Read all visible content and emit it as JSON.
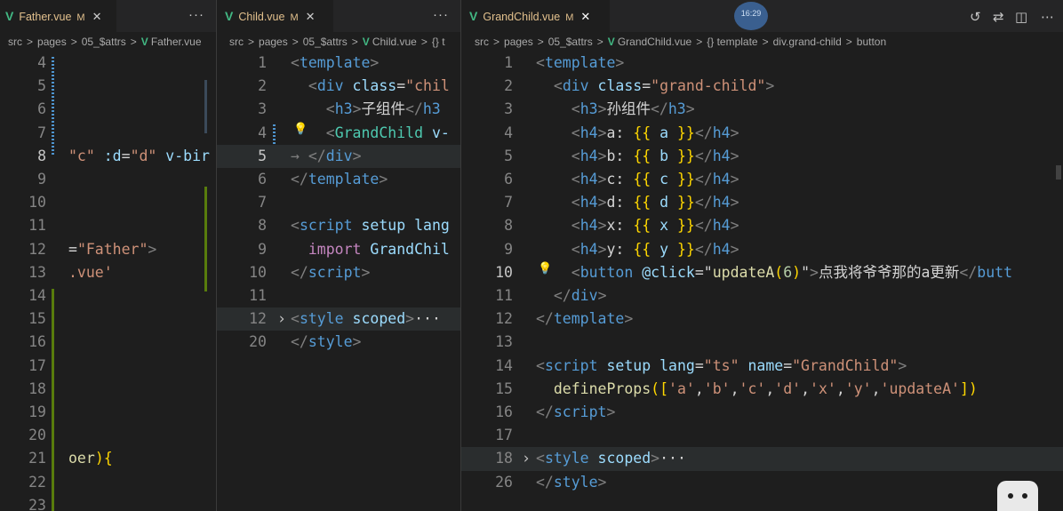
{
  "panes": [
    {
      "tab": {
        "name": "Father.vue",
        "modified": "M",
        "close": "✕"
      },
      "more": "···",
      "breadcrumb": [
        "src",
        "pages",
        "05_$attrs",
        "Father.vue"
      ],
      "lines": [
        {
          "n": "4",
          "t": []
        },
        {
          "n": "5",
          "t": []
        },
        {
          "n": "6",
          "t": []
        },
        {
          "n": "7",
          "t": []
        },
        {
          "n": "8",
          "t": [
            [
              "sv",
              "\"c\""
            ],
            [
              "an",
              " :d"
            ],
            [
              "pl",
              "="
            ],
            [
              "sv",
              "\"d\""
            ],
            [
              "an",
              " v-bir"
            ]
          ]
        },
        {
          "n": "9",
          "t": []
        },
        {
          "n": "10",
          "t": []
        },
        {
          "n": "11",
          "t": []
        },
        {
          "n": "12",
          "t": [
            [
              "pl",
              "="
            ],
            [
              "sv",
              "\"Father\""
            ],
            [
              "tb",
              ">"
            ]
          ]
        },
        {
          "n": "13",
          "t": [
            [
              "sv",
              ".vue'"
            ]
          ]
        },
        {
          "n": "14",
          "t": []
        },
        {
          "n": "15",
          "t": []
        },
        {
          "n": "16",
          "t": []
        },
        {
          "n": "17",
          "t": []
        },
        {
          "n": "18",
          "t": []
        },
        {
          "n": "19",
          "t": []
        },
        {
          "n": "20",
          "t": []
        },
        {
          "n": "21",
          "t": [
            [
              "fn",
              "oer"
            ],
            [
              "br",
              ")"
            ],
            [
              "br",
              "{"
            ]
          ]
        },
        {
          "n": "22",
          "t": []
        },
        {
          "n": "23",
          "t": []
        }
      ]
    },
    {
      "tab": {
        "name": "Child.vue",
        "modified": "M",
        "close": "✕"
      },
      "more": "···",
      "breadcrumb": [
        "src",
        "pages",
        "05_$attrs",
        "Child.vue",
        "{} t"
      ],
      "lines": [
        {
          "n": "1",
          "t": [
            [
              "tb",
              "<"
            ],
            [
              "tg",
              "template"
            ],
            [
              "tb",
              ">"
            ]
          ]
        },
        {
          "n": "2",
          "t": [
            [
              "pl",
              "  "
            ],
            [
              "tb",
              "<"
            ],
            [
              "tg",
              "div"
            ],
            [
              "an",
              " class"
            ],
            [
              "pl",
              "="
            ],
            [
              "sv",
              "\"chil"
            ]
          ]
        },
        {
          "n": "3",
          "t": [
            [
              "pl",
              "    "
            ],
            [
              "tb",
              "<"
            ],
            [
              "tg",
              "h3"
            ],
            [
              "tb",
              ">"
            ],
            [
              "pl",
              "子组件"
            ],
            [
              "tb",
              "</"
            ],
            [
              "tg",
              "h3"
            ]
          ]
        },
        {
          "n": "4",
          "t": [
            [
              "pl",
              "    "
            ],
            [
              "tb",
              "<"
            ],
            [
              "cp",
              "GrandChild"
            ],
            [
              "an",
              " v-"
            ]
          ]
        },
        {
          "n": "5",
          "t": [
            [
              "tb",
              "→ "
            ],
            [
              "tb",
              "</"
            ],
            [
              "tg",
              "div"
            ],
            [
              "tb",
              ">"
            ]
          ]
        },
        {
          "n": "6",
          "t": [
            [
              "tb",
              "</"
            ],
            [
              "tg",
              "template"
            ],
            [
              "tb",
              ">"
            ]
          ]
        },
        {
          "n": "7",
          "t": []
        },
        {
          "n": "8",
          "t": [
            [
              "tb",
              "<"
            ],
            [
              "tg",
              "script"
            ],
            [
              "an",
              " setup"
            ],
            [
              "an",
              " lang"
            ]
          ]
        },
        {
          "n": "9",
          "t": [
            [
              "pl",
              "  "
            ],
            [
              "kw",
              "import"
            ],
            [
              "id",
              " GrandChil"
            ]
          ]
        },
        {
          "n": "10",
          "t": [
            [
              "tb",
              "</"
            ],
            [
              "tg",
              "script"
            ],
            [
              "tb",
              ">"
            ]
          ]
        },
        {
          "n": "11",
          "t": []
        },
        {
          "n": "12",
          "t": [
            [
              "tb",
              "<"
            ],
            [
              "tg",
              "style"
            ],
            [
              "an",
              " scoped"
            ],
            [
              "tb",
              ">"
            ],
            [
              "pl",
              "···"
            ]
          ]
        },
        {
          "n": "20",
          "t": [
            [
              "tb",
              "</"
            ],
            [
              "tg",
              "style"
            ],
            [
              "tb",
              ">"
            ]
          ]
        }
      ]
    },
    {
      "tab": {
        "name": "GrandChild.vue",
        "modified": "M",
        "close": "✕"
      },
      "breadcrumb": [
        "src",
        "pages",
        "05_$attrs",
        "GrandChild.vue",
        "{} template",
        "div.grand-child",
        "button"
      ],
      "avatar": "16:29",
      "lines": [
        {
          "n": "1",
          "t": [
            [
              "tb",
              "<"
            ],
            [
              "tg",
              "template"
            ],
            [
              "tb",
              ">"
            ]
          ]
        },
        {
          "n": "2",
          "t": [
            [
              "pl",
              "  "
            ],
            [
              "tb",
              "<"
            ],
            [
              "tg",
              "div"
            ],
            [
              "an",
              " class"
            ],
            [
              "pl",
              "="
            ],
            [
              "sv",
              "\"grand-child\""
            ],
            [
              "tb",
              ">"
            ]
          ]
        },
        {
          "n": "3",
          "t": [
            [
              "pl",
              "    "
            ],
            [
              "tb",
              "<"
            ],
            [
              "tg",
              "h3"
            ],
            [
              "tb",
              ">"
            ],
            [
              "pl",
              "孙组件"
            ],
            [
              "tb",
              "</"
            ],
            [
              "tg",
              "h3"
            ],
            [
              "tb",
              ">"
            ]
          ]
        },
        {
          "n": "4",
          "t": [
            [
              "pl",
              "    "
            ],
            [
              "tb",
              "<"
            ],
            [
              "tg",
              "h4"
            ],
            [
              "tb",
              ">"
            ],
            [
              "pl",
              "a: "
            ],
            [
              "br",
              "{{"
            ],
            [
              "id",
              " a "
            ],
            [
              "br",
              "}}"
            ],
            [
              "tb",
              "</"
            ],
            [
              "tg",
              "h4"
            ],
            [
              "tb",
              ">"
            ]
          ]
        },
        {
          "n": "5",
          "t": [
            [
              "pl",
              "    "
            ],
            [
              "tb",
              "<"
            ],
            [
              "tg",
              "h4"
            ],
            [
              "tb",
              ">"
            ],
            [
              "pl",
              "b: "
            ],
            [
              "br",
              "{{"
            ],
            [
              "id",
              " b "
            ],
            [
              "br",
              "}}"
            ],
            [
              "tb",
              "</"
            ],
            [
              "tg",
              "h4"
            ],
            [
              "tb",
              ">"
            ]
          ]
        },
        {
          "n": "6",
          "t": [
            [
              "pl",
              "    "
            ],
            [
              "tb",
              "<"
            ],
            [
              "tg",
              "h4"
            ],
            [
              "tb",
              ">"
            ],
            [
              "pl",
              "c: "
            ],
            [
              "br",
              "{{"
            ],
            [
              "id",
              " c "
            ],
            [
              "br",
              "}}"
            ],
            [
              "tb",
              "</"
            ],
            [
              "tg",
              "h4"
            ],
            [
              "tb",
              ">"
            ]
          ]
        },
        {
          "n": "7",
          "t": [
            [
              "pl",
              "    "
            ],
            [
              "tb",
              "<"
            ],
            [
              "tg",
              "h4"
            ],
            [
              "tb",
              ">"
            ],
            [
              "pl",
              "d: "
            ],
            [
              "br",
              "{{"
            ],
            [
              "id",
              " d "
            ],
            [
              "br",
              "}}"
            ],
            [
              "tb",
              "</"
            ],
            [
              "tg",
              "h4"
            ],
            [
              "tb",
              ">"
            ]
          ]
        },
        {
          "n": "8",
          "t": [
            [
              "pl",
              "    "
            ],
            [
              "tb",
              "<"
            ],
            [
              "tg",
              "h4"
            ],
            [
              "tb",
              ">"
            ],
            [
              "pl",
              "x: "
            ],
            [
              "br",
              "{{"
            ],
            [
              "id",
              " x "
            ],
            [
              "br",
              "}}"
            ],
            [
              "tb",
              "</"
            ],
            [
              "tg",
              "h4"
            ],
            [
              "tb",
              ">"
            ]
          ]
        },
        {
          "n": "9",
          "t": [
            [
              "pl",
              "    "
            ],
            [
              "tb",
              "<"
            ],
            [
              "tg",
              "h4"
            ],
            [
              "tb",
              ">"
            ],
            [
              "pl",
              "y: "
            ],
            [
              "br",
              "{{"
            ],
            [
              "id",
              " y "
            ],
            [
              "br",
              "}}"
            ],
            [
              "tb",
              "</"
            ],
            [
              "tg",
              "h4"
            ],
            [
              "tb",
              ">"
            ]
          ]
        },
        {
          "n": "10",
          "t": [
            [
              "pl",
              "    "
            ],
            [
              "tb",
              "<"
            ],
            [
              "tg",
              "button"
            ],
            [
              "an",
              " @click"
            ],
            [
              "pl",
              "="
            ],
            [
              "pl",
              "\""
            ],
            [
              "fn",
              "updateA"
            ],
            [
              "br",
              "("
            ],
            [
              "nm",
              "6"
            ],
            [
              "br",
              ")"
            ],
            [
              "pl",
              "\""
            ],
            [
              "tb",
              ">"
            ],
            [
              "pl",
              "点我将爷爷那的a更新"
            ],
            [
              "tb",
              "</"
            ],
            [
              "tg",
              "butt"
            ]
          ]
        },
        {
          "n": "11",
          "t": [
            [
              "pl",
              "  "
            ],
            [
              "tb",
              "</"
            ],
            [
              "tg",
              "div"
            ],
            [
              "tb",
              ">"
            ]
          ]
        },
        {
          "n": "12",
          "t": [
            [
              "tb",
              "</"
            ],
            [
              "tg",
              "template"
            ],
            [
              "tb",
              ">"
            ]
          ]
        },
        {
          "n": "13",
          "t": []
        },
        {
          "n": "14",
          "t": [
            [
              "tb",
              "<"
            ],
            [
              "tg",
              "script"
            ],
            [
              "an",
              " setup"
            ],
            [
              "an",
              " lang"
            ],
            [
              "pl",
              "="
            ],
            [
              "sv",
              "\"ts\""
            ],
            [
              "an",
              " name"
            ],
            [
              "pl",
              "="
            ],
            [
              "sv",
              "\"GrandChild\""
            ],
            [
              "tb",
              ">"
            ]
          ]
        },
        {
          "n": "15",
          "t": [
            [
              "pl",
              "  "
            ],
            [
              "fn",
              "defineProps"
            ],
            [
              "br",
              "(["
            ],
            [
              "sv",
              "'a'"
            ],
            [
              "pl",
              ","
            ],
            [
              "sv",
              "'b'"
            ],
            [
              "pl",
              ","
            ],
            [
              "sv",
              "'c'"
            ],
            [
              "pl",
              ","
            ],
            [
              "sv",
              "'d'"
            ],
            [
              "pl",
              ","
            ],
            [
              "sv",
              "'x'"
            ],
            [
              "pl",
              ","
            ],
            [
              "sv",
              "'y'"
            ],
            [
              "pl",
              ","
            ],
            [
              "sv",
              "'updateA'"
            ],
            [
              "br",
              "])"
            ]
          ]
        },
        {
          "n": "16",
          "t": [
            [
              "tb",
              "</"
            ],
            [
              "tg",
              "script"
            ],
            [
              "tb",
              ">"
            ]
          ]
        },
        {
          "n": "17",
          "t": []
        },
        {
          "n": "18",
          "t": [
            [
              "tb",
              "<"
            ],
            [
              "tg",
              "style"
            ],
            [
              "an",
              " scoped"
            ],
            [
              "tb",
              ">"
            ],
            [
              "pl",
              "···"
            ]
          ]
        },
        {
          "n": "26",
          "t": [
            [
              "tb",
              "</"
            ],
            [
              "tg",
              "style"
            ],
            [
              "tb",
              ">"
            ]
          ]
        }
      ]
    }
  ]
}
